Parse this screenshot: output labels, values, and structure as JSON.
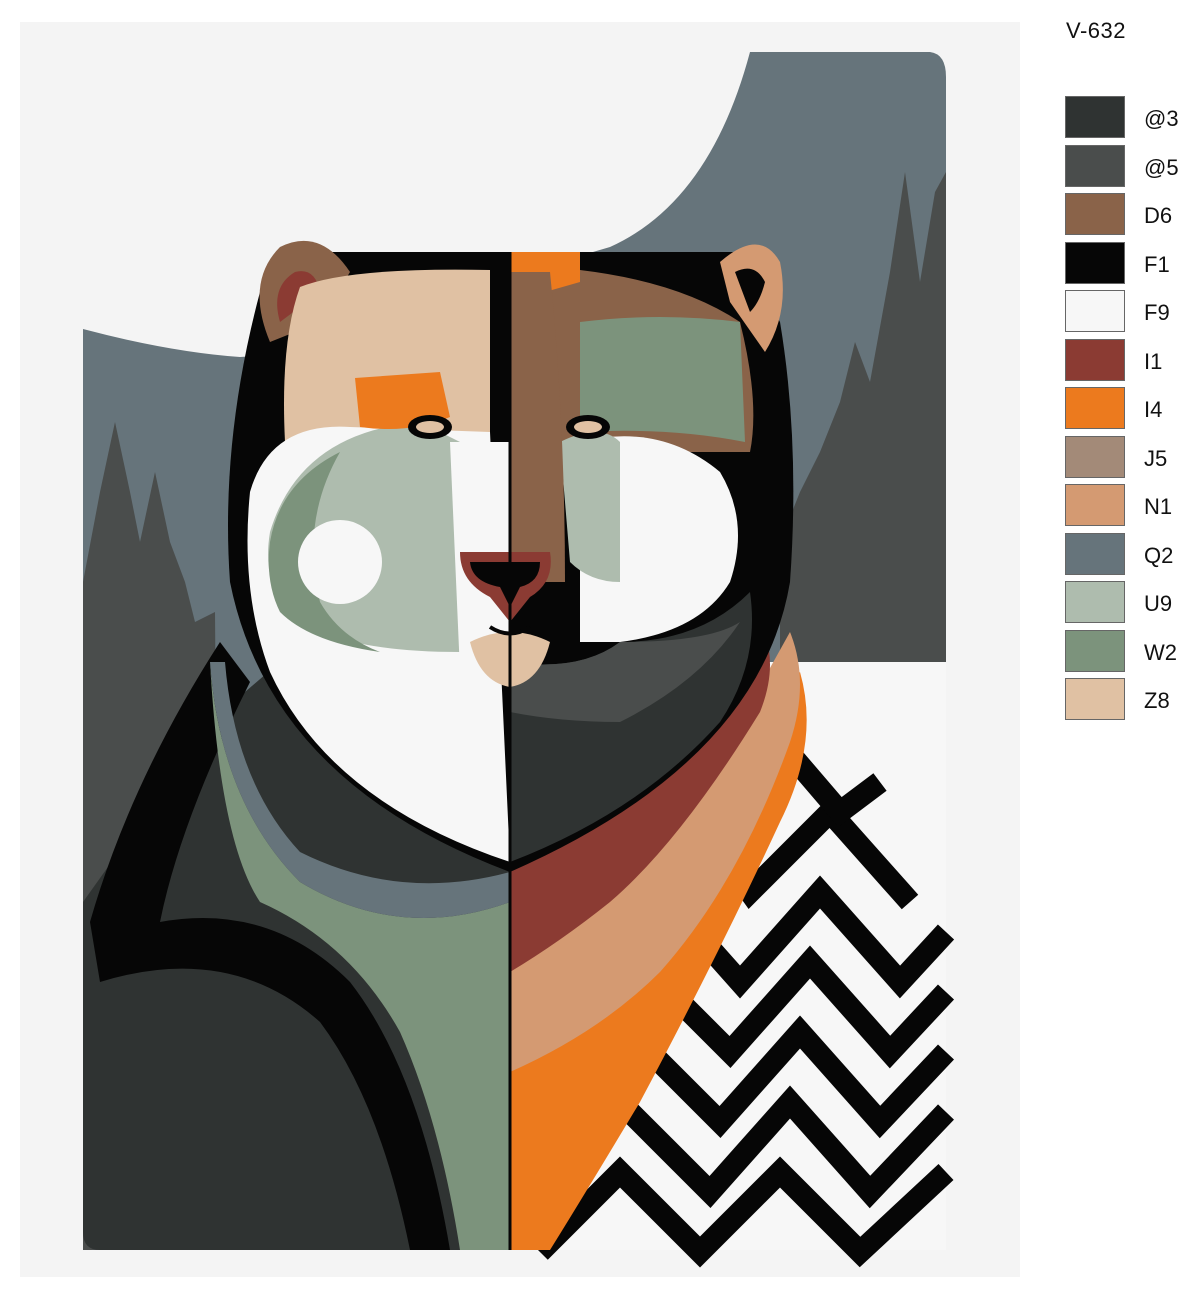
{
  "product_code": "V-632",
  "palette": [
    {
      "code": "@3",
      "color": "#2f3332"
    },
    {
      "code": "@5",
      "color": "#4a4d4c"
    },
    {
      "code": "D6",
      "color": "#8a6349"
    },
    {
      "code": "F1",
      "color": "#060606"
    },
    {
      "code": "F9",
      "color": "#f7f7f7"
    },
    {
      "code": "I1",
      "color": "#8b3b33"
    },
    {
      "code": "I4",
      "color": "#ec7a1e"
    },
    {
      "code": "J5",
      "color": "#a38a78"
    },
    {
      "code": "N1",
      "color": "#d49a72"
    },
    {
      "code": "Q2",
      "color": "#66747b"
    },
    {
      "code": "U9",
      "color": "#aebcae"
    },
    {
      "code": "W2",
      "color": "#7c937c"
    },
    {
      "code": "Z8",
      "color": "#e0c1a3"
    }
  ]
}
